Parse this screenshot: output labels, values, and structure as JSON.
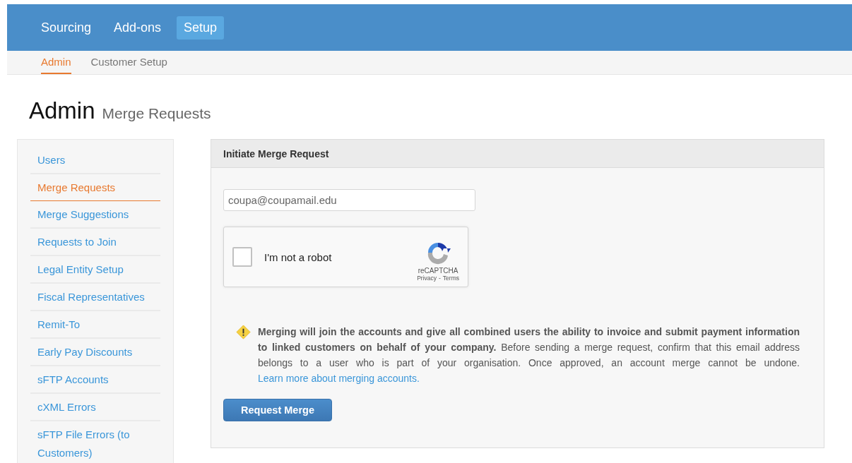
{
  "top_nav": [
    {
      "label": "Sourcing",
      "selected": false
    },
    {
      "label": "Add-ons",
      "selected": false
    },
    {
      "label": "Setup",
      "selected": true
    }
  ],
  "sub_nav": [
    {
      "label": "Admin",
      "selected": true
    },
    {
      "label": "Customer Setup",
      "selected": false
    }
  ],
  "page_title": {
    "title": "Admin",
    "subtitle": "Merge Requests"
  },
  "sidebar": {
    "items": [
      {
        "label": "Users",
        "selected": false
      },
      {
        "label": "Merge Requests",
        "selected": true
      },
      {
        "label": "Merge Suggestions",
        "selected": false
      },
      {
        "label": "Requests to Join",
        "selected": false
      },
      {
        "label": "Legal Entity Setup",
        "selected": false
      },
      {
        "label": "Fiscal Representatives",
        "selected": false
      },
      {
        "label": "Remit-To",
        "selected": false
      },
      {
        "label": "Early Pay Discounts",
        "selected": false
      },
      {
        "label": "sFTP Accounts",
        "selected": false
      },
      {
        "label": "cXML Errors",
        "selected": false
      },
      {
        "label": "sFTP File Errors (to Customers)",
        "selected": false
      }
    ]
  },
  "panel": {
    "title": "Initiate Merge Request",
    "email": {
      "value": "coupa@coupamail.edu"
    },
    "captcha": {
      "label": "I'm not a robot",
      "checked": false,
      "brand": "reCAPTCHA",
      "privacy": "Privacy",
      "separator": "-",
      "terms": "Terms"
    },
    "warning": {
      "text": "**Merging will join the accounts and give all combined users the ability to invoice and submit payment information to linked customers on behalf of your company.** Before sending a merge request, confirm that this email address belongs to a user who is part of your organisation. Once approved, an account merge cannot be undone.",
      "link": "Learn more about merging accounts."
    },
    "button": "Request Merge"
  }
}
